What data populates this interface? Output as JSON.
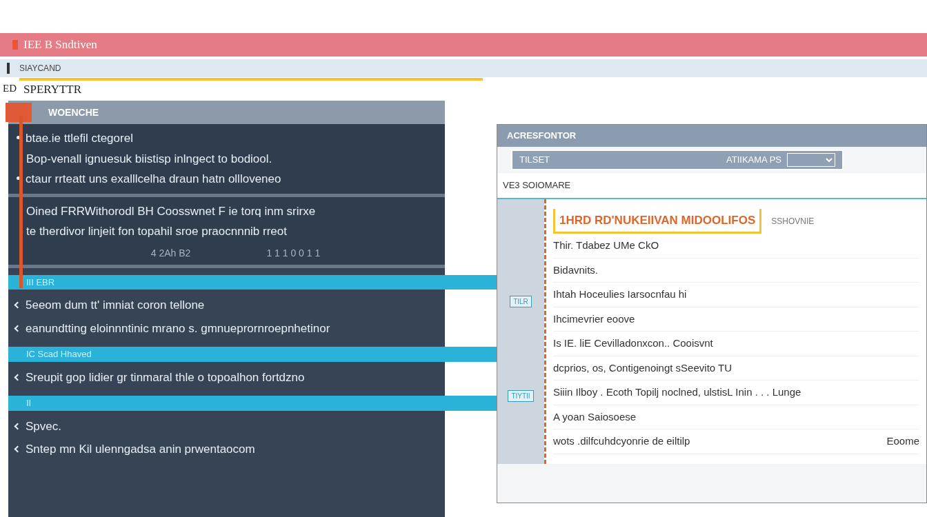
{
  "window": {
    "title": "IEE B Sndtiven"
  },
  "toolbar": {
    "label": "SIAYCAND"
  },
  "search": {
    "label": "ED",
    "value": "SPERYTTR"
  },
  "left_panel": {
    "title": "WOENCHE",
    "blocks": [
      {
        "lines": [
          {
            "text": "btae.ie ttlefil ctegorel",
            "bullet": true
          },
          {
            "text": "Bop-venall ignuesuk biistisp inlngect to bodiool.",
            "bullet": false
          },
          {
            "text": "ctaur rrteatt uns exalllcelha draun  hatn ollloveneo",
            "bullet": true
          }
        ]
      },
      {
        "lines": [
          {
            "text": "Oined FRRWithorodl BH Coosswnet F ie torq inm srirxe",
            "bullet": false
          },
          {
            "text": "te therdivor linjeit  fon topahil sroe praocnnnib rreot",
            "bullet": false
          }
        ],
        "numbers": [
          "4 2Ah  B2",
          "1 1 1 0 0 1 1"
        ]
      }
    ],
    "items": [
      {
        "kind": "bar",
        "text": "III EBR"
      },
      {
        "kind": "line",
        "text": "5eeom dum tt' imniat coron tellone"
      },
      {
        "kind": "line",
        "text": "eanundtting eloinnntinic mrano s. gmnueprornroepnhetinor"
      },
      {
        "kind": "bar",
        "text": "IC Scad Hhaved"
      },
      {
        "kind": "line",
        "text": "Sreupit gop  lidier gr tinmaral thle o topoalhon fortdzno"
      },
      {
        "kind": "bar",
        "text": "II"
      },
      {
        "kind": "line",
        "text": "Spvec."
      },
      {
        "kind": "line",
        "text": "Sntep mn Kil ulenngadsa anin prwentaocom"
      }
    ]
  },
  "right_panel": {
    "title": "ACRESFONTOR",
    "filter": {
      "label": "TILSET",
      "value": "ATIIKAMA PS"
    },
    "path": "VE3 SOIOMARE",
    "heading": "1HRD RD'NUKEIIVAN MIDOOLIFOS",
    "heading_note": "SSHOVNIE",
    "rows": [
      {
        "text": "Thir. Tdabez UMe CkO"
      },
      {
        "text": "Bidavnits."
      },
      {
        "text": "Ihtah  Hoceulies Iarsocnfau hi"
      },
      {
        "text": "Ihcimevrier  eoove"
      },
      {
        "text": "Is IE. liE Cevilladonxcon.. Cooisvnt"
      },
      {
        "text": "dcprios,  os, Contigenoingt sSeevito  TU"
      },
      {
        "text": "Siiin Ilboy . Ecoth Topilj noclned, ulstisL Inin . . . Lunge"
      },
      {
        "text": "A yoan Saiosoese"
      },
      {
        "text": "wots .dilfcuhdcyonrie de eiltilp",
        "note": "Eoome"
      }
    ],
    "tags": [
      "TILR",
      "TIYTII"
    ]
  }
}
